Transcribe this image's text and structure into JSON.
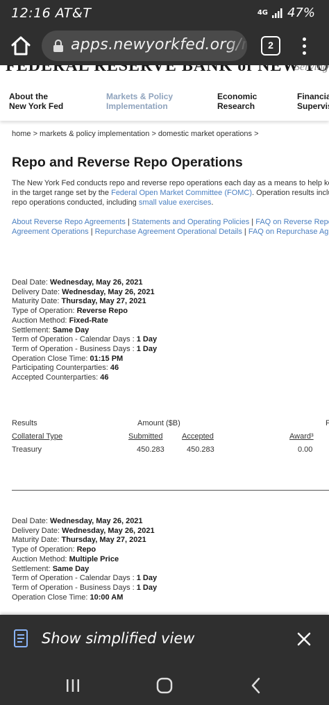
{
  "status_bar": {
    "time": "12:16 AT&T",
    "network": "4G",
    "battery": "47%"
  },
  "browser": {
    "url": "apps.newyorkfed.org/mc",
    "tab_count": "2"
  },
  "site": {
    "banner_title": "FEDERAL RESERVE BANK of NEW YORK",
    "banner_sub": "Serving",
    "nav": [
      {
        "line1": "About the",
        "line2": "New York Fed"
      },
      {
        "line1": "Markets & Policy",
        "line2": "Implementation"
      },
      {
        "line1": "Economic",
        "line2": "Research"
      },
      {
        "line1": "Financial",
        "line2": "Supervisi"
      }
    ]
  },
  "breadcrumb": "home > markets & policy implementation > domestic market operations >",
  "page_title": "Repo and Reverse Repo Operations",
  "intro": {
    "text1": "The New York Fed conducts repo and reverse repo operations each day as a means to help keep the f",
    "text2": "in the target range set by the ",
    "link1": "Federal Open Market Committee (FOMC)",
    "text3": ". Operation results include all re",
    "text4": "repo operations conducted, including ",
    "link2": "small value exercises",
    "text5": "."
  },
  "links": {
    "l1": "About Reverse Repo Agreements",
    "l2": "Statements and Operating Policies",
    "l3": "FAQ on Reverse Repo",
    "l4": "Agreement Operations",
    "l5": "Repurchase Agreement Operational Details",
    "l6": "FAQ on Repurchase Agreement"
  },
  "operation1": {
    "deal_date_label": "Deal Date:",
    "deal_date": "Wednesday, May 26, 2021",
    "delivery_date_label": "Delivery Date:",
    "delivery_date": "Wednesday, May 26, 2021",
    "maturity_date_label": "Maturity Date:",
    "maturity_date": "Thursday, May 27, 2021",
    "type_label": "Type of Operation:",
    "type": "Reverse Repo",
    "auction_label": "Auction Method:",
    "auction": "Fixed-Rate",
    "settlement_label": "Settlement:",
    "settlement": "Same Day",
    "term_cal_label": "Term of Operation - Calendar Days :",
    "term_cal": "1 Day",
    "term_bus_label": "Term of Operation - Business Days :",
    "term_bus": "1 Day",
    "close_label": "Operation Close Time:",
    "close": "01:15 PM",
    "participating_label": "Participating Counterparties:",
    "participating": "46",
    "accepted_label": "Accepted Counterparties:",
    "accepted": "46"
  },
  "results": {
    "results_label": "Results",
    "amount_label": "Amount ($B)",
    "edge_label": "F",
    "col_collateral": "Collateral Type",
    "col_submitted": "Submitted",
    "col_accepted": "Accepted",
    "col_award": "Award³",
    "row_type": "Treasury",
    "row_submitted": "450.283",
    "row_accepted": "450.283",
    "row_award": "0.00"
  },
  "operation2": {
    "deal_date_label": "Deal Date:",
    "deal_date": "Wednesday, May 26, 2021",
    "delivery_date_label": "Delivery Date:",
    "delivery_date": "Wednesday, May 26, 2021",
    "maturity_date_label": "Maturity Date:",
    "maturity_date": "Thursday, May 27, 2021",
    "type_label": "Type of Operation:",
    "type": "Repo",
    "auction_label": "Auction Method:",
    "auction": "Multiple Price",
    "settlement_label": "Settlement:",
    "settlement": "Same Day",
    "term_cal_label": "Term of Operation - Calendar Days :",
    "term_cal": "1 Day",
    "term_bus_label": "Term of Operation - Business Days :",
    "term_bus": "1 Day",
    "close_label": "Operation Close Time:",
    "close": "10:00 AM"
  },
  "simplified_view": {
    "label": "Show simplified view"
  },
  "colors": {
    "chrome": "#2f2f2f",
    "link": "#4a7fc1",
    "nav_active": "#8fa3bd"
  }
}
